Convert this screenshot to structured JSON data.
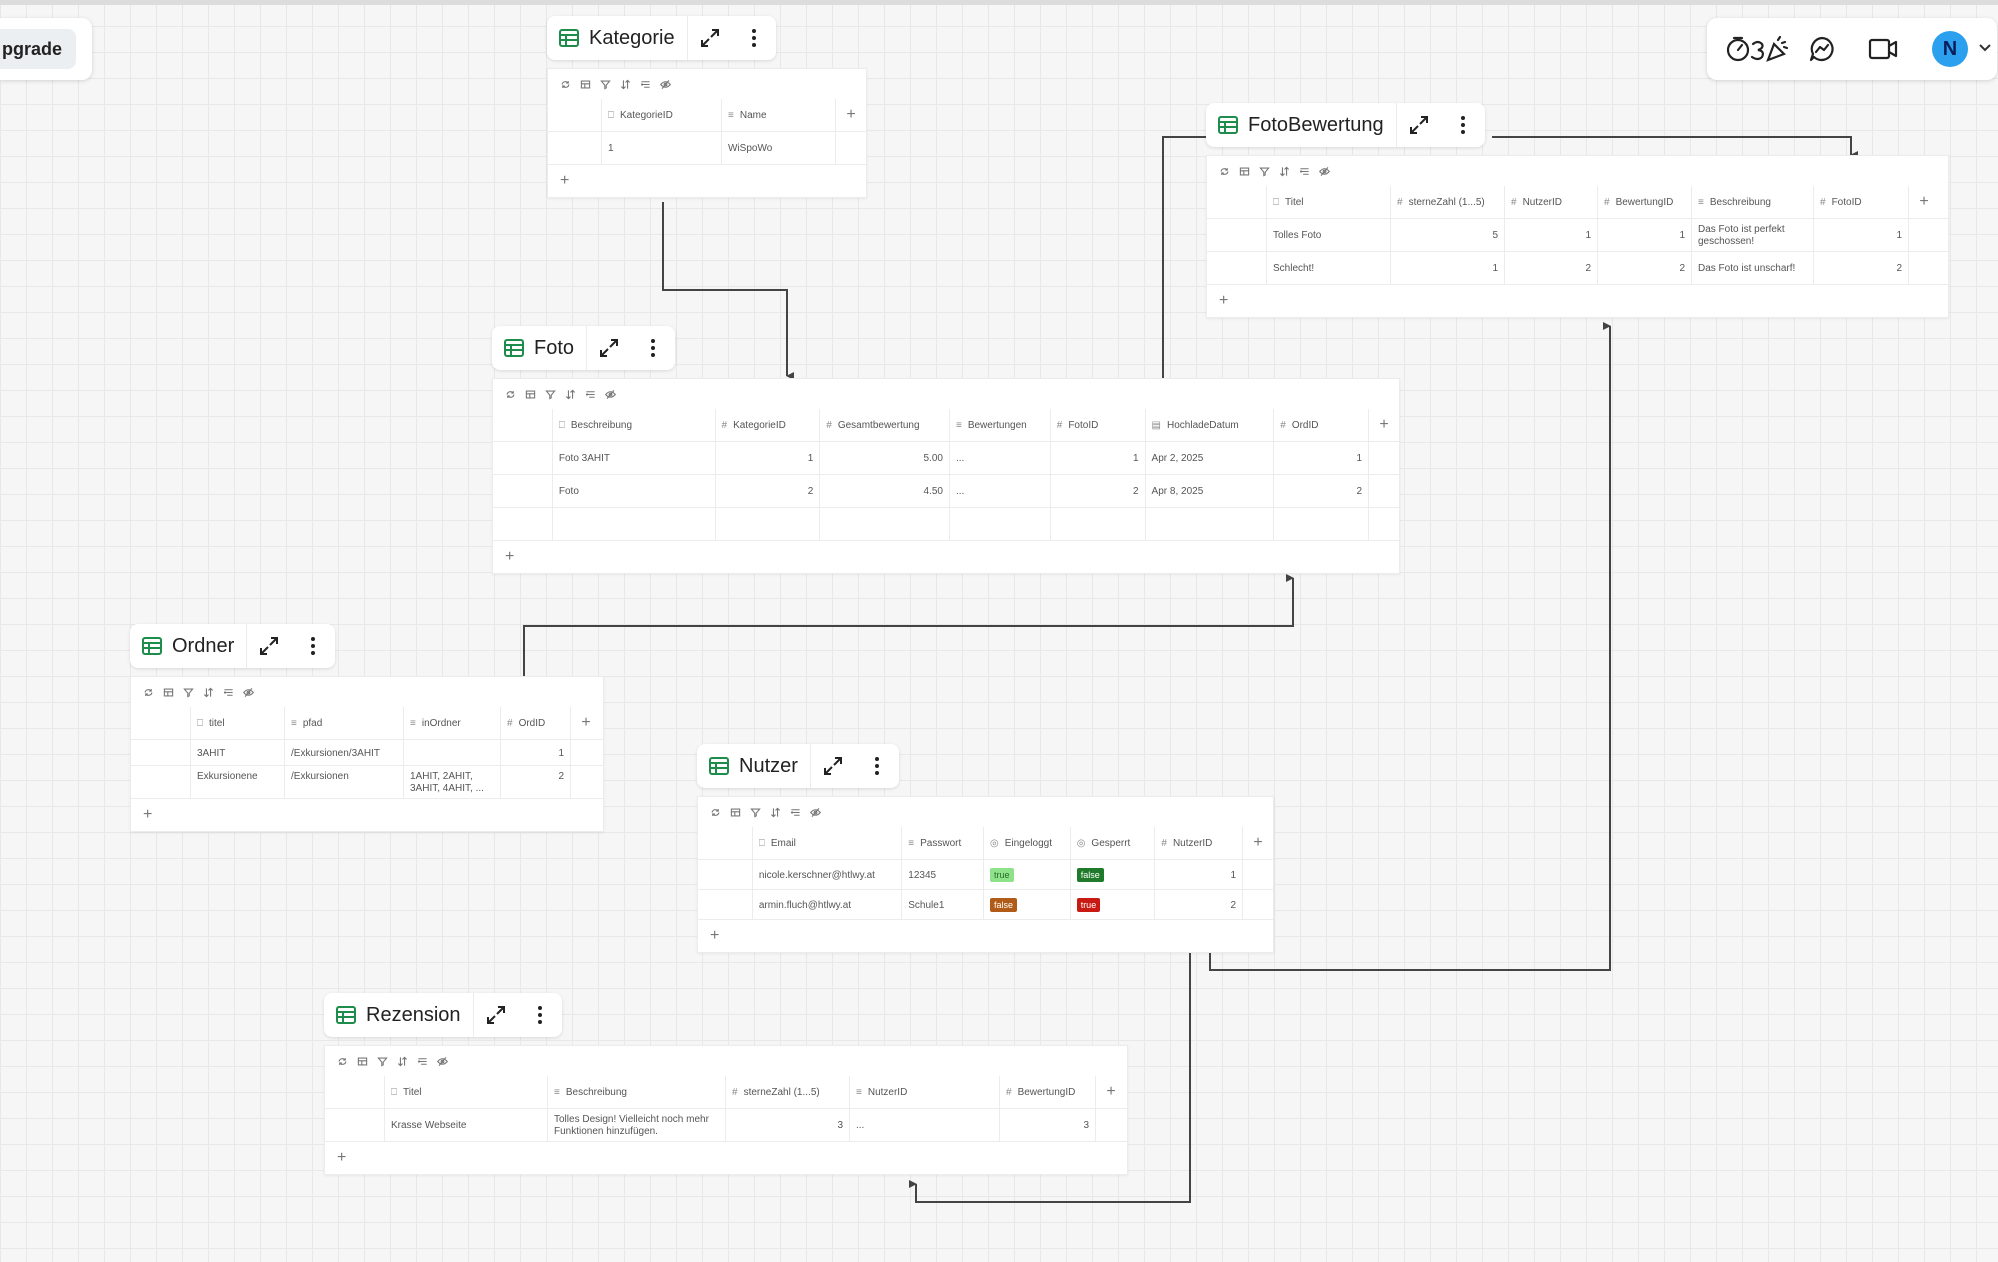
{
  "toolbar": {
    "upgrade_label": "pgrade",
    "avatar_initial": "N"
  },
  "colors": {
    "accent_green": "#1e8c4a",
    "avatar_bg": "#2aa0ee",
    "connector": "#444444"
  },
  "icons": {
    "table": "table-grid-icon",
    "expand": "expand-arrows-icon",
    "more": "vertical-dots-icon",
    "timer": "timer-icon",
    "celebrate": "party-popper-icon",
    "chat": "chat-bubble-icon",
    "video": "video-camera-icon"
  },
  "tables": {
    "kategorie": {
      "name": "Kategorie",
      "columns": [
        {
          "sym": "⎕",
          "label": "KategorieID"
        },
        {
          "sym": "≡",
          "label": "Name"
        }
      ],
      "rows": [
        [
          "1",
          "WiSpoWo"
        ]
      ]
    },
    "foto": {
      "name": "Foto",
      "columns": [
        {
          "sym": "⎕",
          "label": "Beschreibung"
        },
        {
          "sym": "#",
          "label": "KategorieID"
        },
        {
          "sym": "#",
          "label": "Gesamtbewertung"
        },
        {
          "sym": "≡",
          "label": "Bewertungen"
        },
        {
          "sym": "#",
          "label": "FotoID"
        },
        {
          "sym": "▤",
          "label": "HochladeDatum"
        },
        {
          "sym": "#",
          "label": "OrdID"
        }
      ],
      "rows": [
        [
          "Foto 3AHIT",
          "1",
          "5.00",
          "...",
          "1",
          "Apr 2, 2025",
          "1"
        ],
        [
          "Foto",
          "2",
          "4.50",
          "...",
          "2",
          "Apr 8, 2025",
          "2"
        ]
      ]
    },
    "fotobewertung": {
      "name": "FotoBewertung",
      "columns": [
        {
          "sym": "⎕",
          "label": "Titel"
        },
        {
          "sym": "#",
          "label": "sterneZahl (1...5)"
        },
        {
          "sym": "#",
          "label": "NutzerID"
        },
        {
          "sym": "#",
          "label": "BewertungID"
        },
        {
          "sym": "≡",
          "label": "Beschreibung"
        },
        {
          "sym": "#",
          "label": "FotoID"
        }
      ],
      "rows": [
        [
          "Tolles Foto",
          "5",
          "1",
          "1",
          "Das Foto ist perfekt geschossen!",
          "1"
        ],
        [
          "Schlecht!",
          "1",
          "2",
          "2",
          "Das Foto ist unscharf!",
          "2"
        ]
      ]
    },
    "ordner": {
      "name": "Ordner",
      "columns": [
        {
          "sym": "⎕",
          "label": "titel"
        },
        {
          "sym": "≡",
          "label": "pfad"
        },
        {
          "sym": "≡",
          "label": "inOrdner"
        },
        {
          "sym": "#",
          "label": "OrdID"
        }
      ],
      "rows": [
        [
          "3AHIT",
          "/Exkursionen/3AHIT",
          "",
          "1"
        ],
        [
          "Exkursionene",
          "/Exkursionen",
          "1AHIT, 2AHIT, 3AHIT, 4AHIT, ...",
          "2"
        ]
      ]
    },
    "nutzer": {
      "name": "Nutzer",
      "columns": [
        {
          "sym": "⎕",
          "label": "Email"
        },
        {
          "sym": "≡",
          "label": "Passwort"
        },
        {
          "sym": "◎",
          "label": "Eingeloggt"
        },
        {
          "sym": "◎",
          "label": "Gesperrt"
        },
        {
          "sym": "#",
          "label": "NutzerID"
        }
      ],
      "rows": [
        [
          "nicole.kerschner@htlwy.at",
          "12345",
          "true",
          "false",
          "1"
        ],
        [
          "armin.fluch@htlwy.at",
          "Schule1",
          "false",
          "true",
          "2"
        ]
      ]
    },
    "rezension": {
      "name": "Rezension",
      "columns": [
        {
          "sym": "⎕",
          "label": "Titel"
        },
        {
          "sym": "≡",
          "label": "Beschreibung"
        },
        {
          "sym": "#",
          "label": "sterneZahl (1...5)"
        },
        {
          "sym": "≡",
          "label": "NutzerID"
        },
        {
          "sym": "#",
          "label": "BewertungID"
        }
      ],
      "rows": [
        [
          "Krasse Webseite",
          "Tolles Design! Vielleicht noch mehr Funktionen hinzufügen.",
          "3",
          "...",
          "3"
        ]
      ]
    }
  }
}
